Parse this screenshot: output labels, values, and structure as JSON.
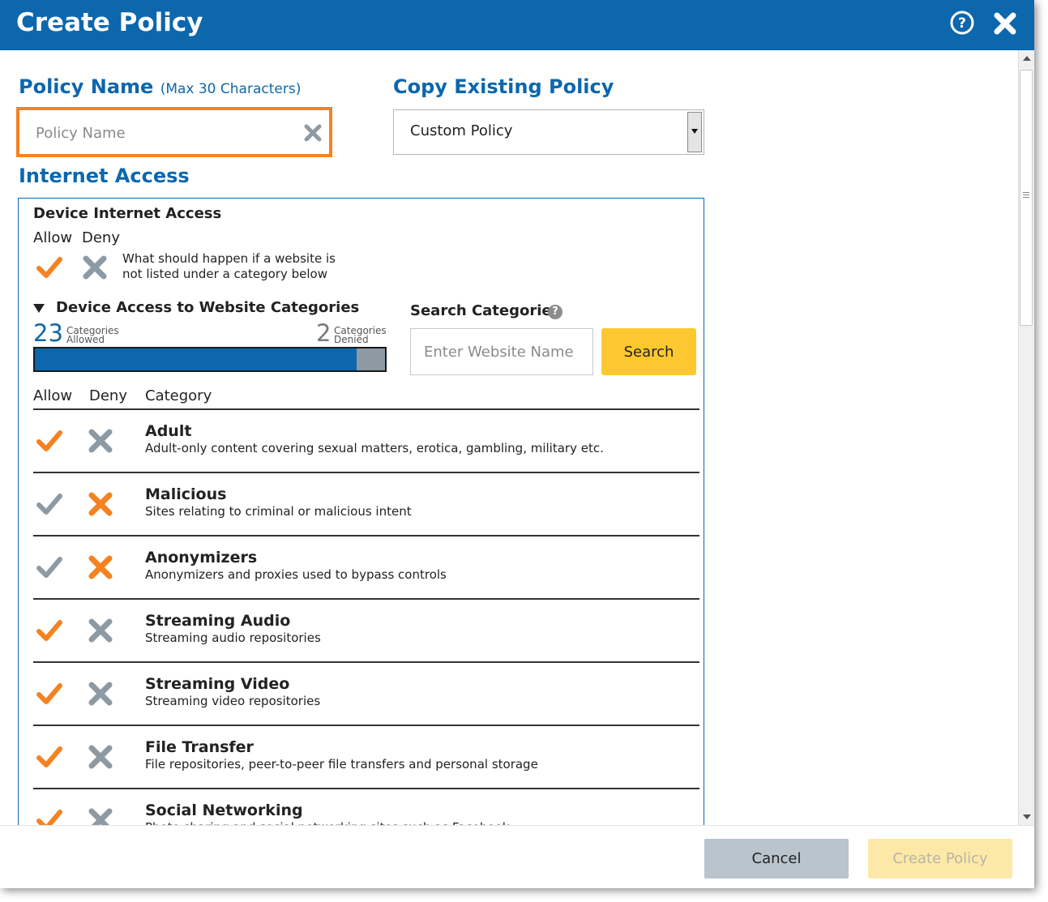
{
  "dialog": {
    "title": "Create Policy",
    "icons": {
      "help": "help-circle-icon",
      "close": "close-x-icon"
    }
  },
  "policy_name": {
    "label": "Policy Name",
    "hint": "(Max 30 Characters)",
    "placeholder": "Policy Name",
    "value": ""
  },
  "copy_policy": {
    "label": "Copy Existing Policy",
    "selected": "Custom Policy"
  },
  "internet_access": {
    "title": "Internet Access",
    "device_access": {
      "title": "Device Internet Access",
      "allow_label": "Allow",
      "deny_label": "Deny",
      "description_line1": "What should happen if a website is",
      "description_line2": "not listed under a category below",
      "state": "allow"
    },
    "website_categories": {
      "title": "Device Access to Website Categories",
      "allowed_count": "23",
      "allowed_label_1": "Categories",
      "allowed_label_2": "Allowed",
      "denied_count": "2",
      "denied_label_1": "Categories",
      "denied_label_2": "Denied",
      "allowed_fraction": 0.92
    },
    "search": {
      "title": "Search Categories",
      "placeholder": "Enter Website Name",
      "button": "Search"
    },
    "table": {
      "headers": {
        "allow": "Allow",
        "deny": "Deny",
        "category": "Category"
      },
      "rows": [
        {
          "name": "Adult",
          "description": "Adult-only content covering sexual matters, erotica, gambling, military etc.",
          "state": "allow"
        },
        {
          "name": "Malicious",
          "description": "Sites relating to criminal or malicious intent",
          "state": "deny"
        },
        {
          "name": "Anonymizers",
          "description": "Anonymizers and proxies used to bypass controls",
          "state": "deny"
        },
        {
          "name": "Streaming Audio",
          "description": "Streaming audio repositories",
          "state": "allow"
        },
        {
          "name": "Streaming Video",
          "description": "Streaming video repositories",
          "state": "allow"
        },
        {
          "name": "File Transfer",
          "description": "File repositories, peer-to-peer file transfers and personal storage",
          "state": "allow"
        },
        {
          "name": "Social Networking",
          "description": "Photo sharing and social networking sites such as Facebook",
          "state": "allow"
        }
      ]
    }
  },
  "footer": {
    "cancel": "Cancel",
    "create": "Create Policy"
  },
  "colors": {
    "brand_blue": "#0c67ad",
    "active_orange": "#f58220",
    "inactive_gray": "#8e9aa3",
    "search_yellow": "#fdc82f",
    "create_disabled": "#fde9a7"
  }
}
